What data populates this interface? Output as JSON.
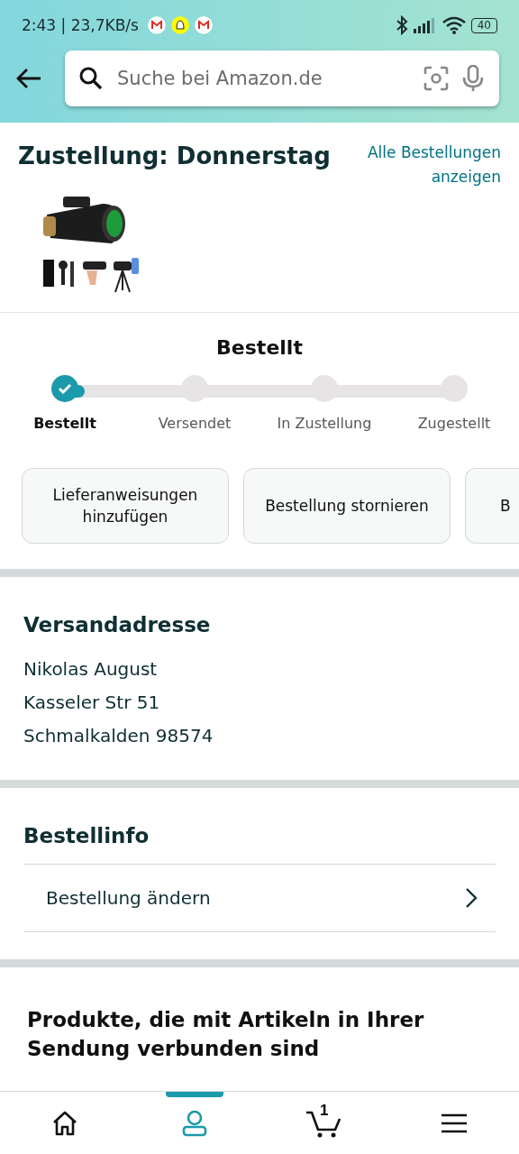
{
  "status_bar": {
    "time": "2:43 | 23,7KB/s",
    "battery": "40"
  },
  "search": {
    "placeholder": "Suche bei Amazon.de"
  },
  "delivery": {
    "title": "Zustellung: Donnerstag",
    "link": "Alle Bestellungen anzeigen"
  },
  "tracking": {
    "title": "Bestellt",
    "steps": [
      {
        "label": "Bestellt",
        "completed": true
      },
      {
        "label": "Versendet",
        "completed": false
      },
      {
        "label": "In Zustellung",
        "completed": false
      },
      {
        "label": "Zugestellt",
        "completed": false
      }
    ]
  },
  "actions": [
    "Lieferanweisungen hinzufügen",
    "Bestellung stornieren",
    "B"
  ],
  "address": {
    "title": "Versandadresse",
    "lines": [
      "Nikolas August",
      "Kasseler Str 51",
      "Schmalkalden 98574"
    ]
  },
  "order_info": {
    "title": "Bestellinfo",
    "items": [
      "Bestellung ändern"
    ]
  },
  "related": {
    "title": "Produkte, die mit Artikeln in Ihrer Sendung verbunden sind"
  },
  "bottom_nav": [
    {
      "kind": "home",
      "selected": false
    },
    {
      "kind": "account",
      "selected": true
    },
    {
      "kind": "cart",
      "selected": false,
      "badge": "1"
    },
    {
      "kind": "menu",
      "selected": false
    }
  ]
}
